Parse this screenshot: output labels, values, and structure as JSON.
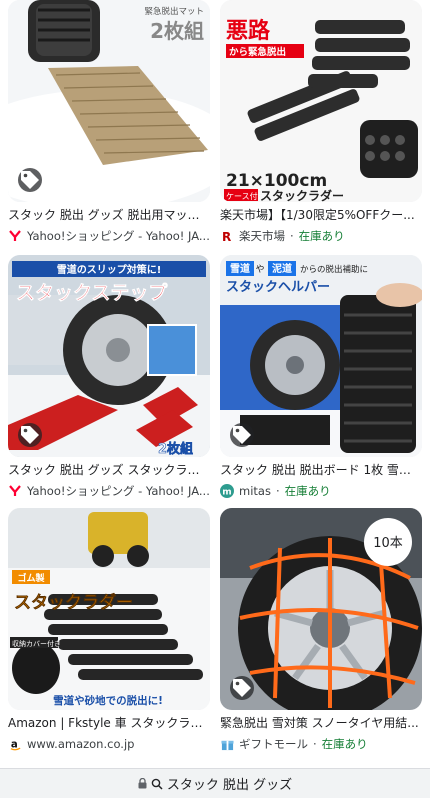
{
  "results": [
    {
      "image_text": [
        "緊急脱出マット",
        "2枚組"
      ],
      "title": "スタック 脱出 グッズ 脱出用マット ...",
      "source": "Yahoo!ショッピング - Yahoo! JA...",
      "favicon": "yahoo-y-icon"
    },
    {
      "image_text": [
        "悪路",
        "から緊急脱出",
        "21×100cm",
        "ケース付き",
        "スタックラダー"
      ],
      "title": "楽天市場】【1/30限定5%OFFクー...",
      "source": "楽天市場",
      "stock": "在庫あり",
      "favicon": "rakuten-r-icon"
    },
    {
      "image_text": [
        "雪道のスリップ対策に!",
        "スタックステップ",
        "2枚組"
      ],
      "title": "スタック 脱出 グッズ スタックラダ...",
      "source": "Yahoo!ショッピング - Yahoo! JA...",
      "favicon": "yahoo-y-icon"
    },
    {
      "image_text": [
        "雪道",
        "や",
        "泥道",
        "からの脱出補助に",
        "スタックヘルパー"
      ],
      "title": "スタック 脱出 脱出ボード 1枚 雪道 ...",
      "source": "mitas",
      "stock": "在庫あり",
      "favicon": "mitas-m-icon"
    },
    {
      "image_text": [
        "ゴム製",
        "スタックラダー",
        "収納カバー付き",
        "雪道や砂地での脱出に!"
      ],
      "title": "Amazon | Fkstyle 車 スタックラダ...",
      "source": "www.amazon.co.jp",
      "favicon": "amazon-a-icon"
    },
    {
      "image_text": [
        "10本"
      ],
      "title": "緊急脱出 雪対策 スノータイヤ用結...",
      "source": "ギフトモール",
      "stock": "在庫あり",
      "favicon": "gift-icon"
    }
  ],
  "separator": "·",
  "search_bar": {
    "query": "スタック 脱出 グッズ",
    "lock_icon": "lock-icon",
    "search_icon": "search-icon"
  },
  "colors": {
    "stock_green": "#188038",
    "yahoo_red": "#ff0033",
    "rakuten_red": "#bf0000",
    "accent_red": "#e60012"
  }
}
